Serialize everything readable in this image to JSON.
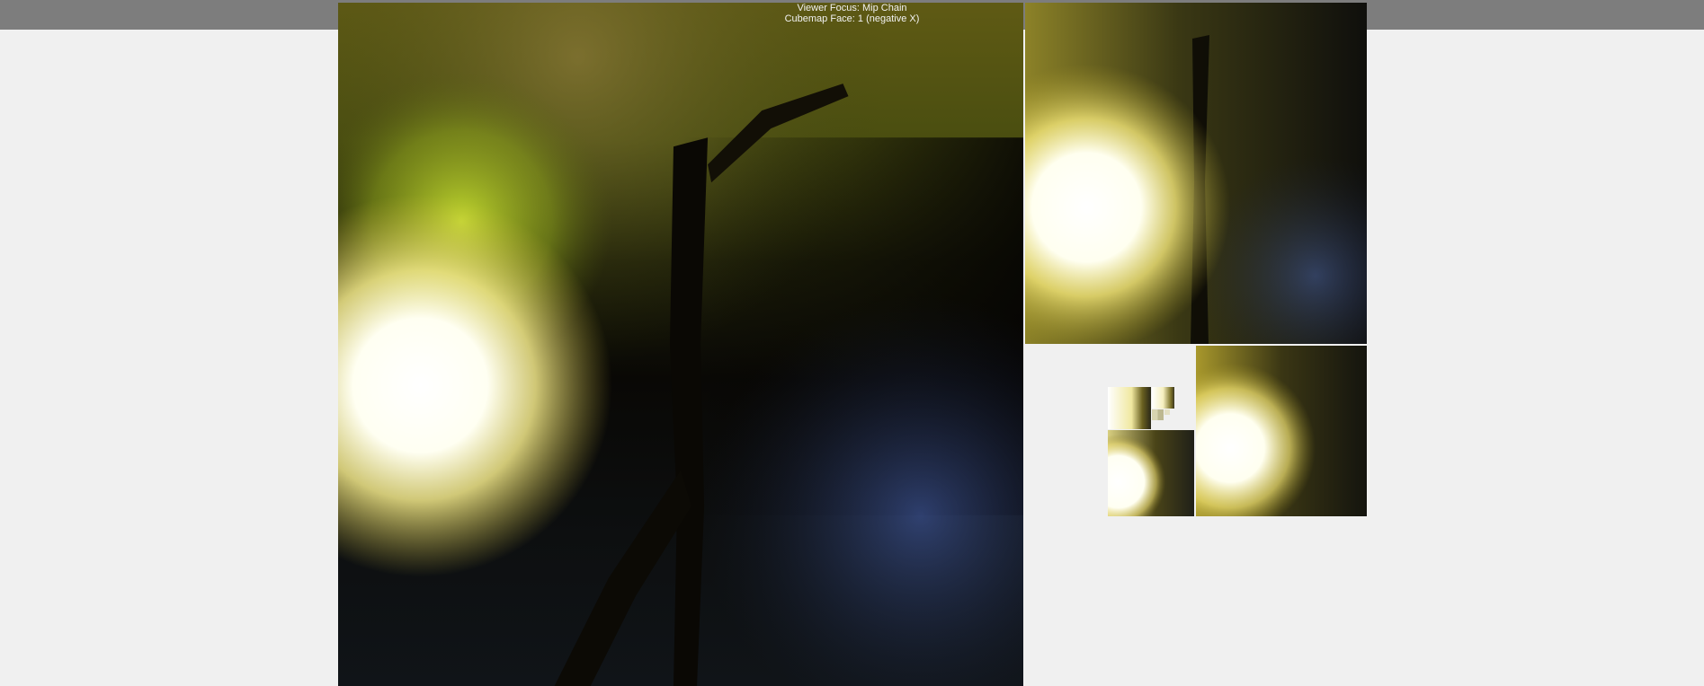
{
  "viewer": {
    "focus_label": "Viewer Focus: Mip Chain",
    "face_label": "Cubemap Face: 1 (negative X)"
  },
  "colors": {
    "top_bar": "#7d7d7d",
    "background": "#f0f0f0",
    "info_text": "#f2f2f2",
    "sun": "#fffff0",
    "foliage": "#6e7a18",
    "shadow": "#0b0a05",
    "sky": "#3a58a8"
  },
  "mip_chain": {
    "face_index": 1,
    "face_name": "negative X",
    "levels": 8
  }
}
